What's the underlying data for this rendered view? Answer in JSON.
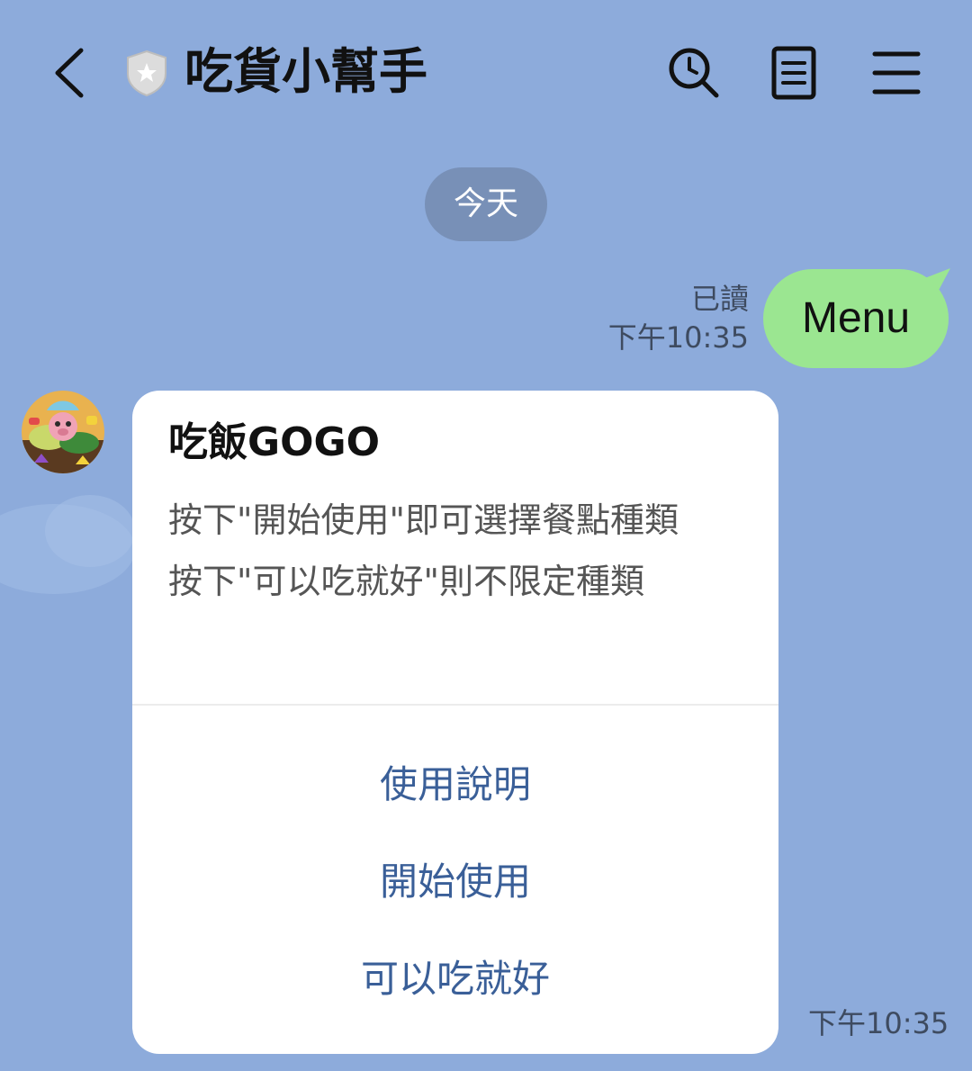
{
  "header": {
    "title": "吃貨小幫手",
    "icons": {
      "back": "back-arrow-icon",
      "shield": "shield-icon",
      "search": "search-icon",
      "notes": "notes-icon",
      "menu": "menu-icon"
    }
  },
  "chat": {
    "date_separator": "今天",
    "sent_message": {
      "text": "Menu",
      "read_status": "已讀",
      "time": "下午10:35",
      "bubble_color": "#9be691"
    },
    "received_card": {
      "title": "吃飯GOGO",
      "lines": [
        "按下\"開始使用\"即可選擇餐點種類",
        "按下\"可以吃就好\"則不限定種類"
      ],
      "actions": [
        "使用說明",
        "開始使用",
        "可以吃就好"
      ],
      "time": "下午10:35",
      "action_color": "#3a5f98"
    }
  },
  "theme": {
    "background": "#8dabdb",
    "date_pill": "#7890b7"
  }
}
